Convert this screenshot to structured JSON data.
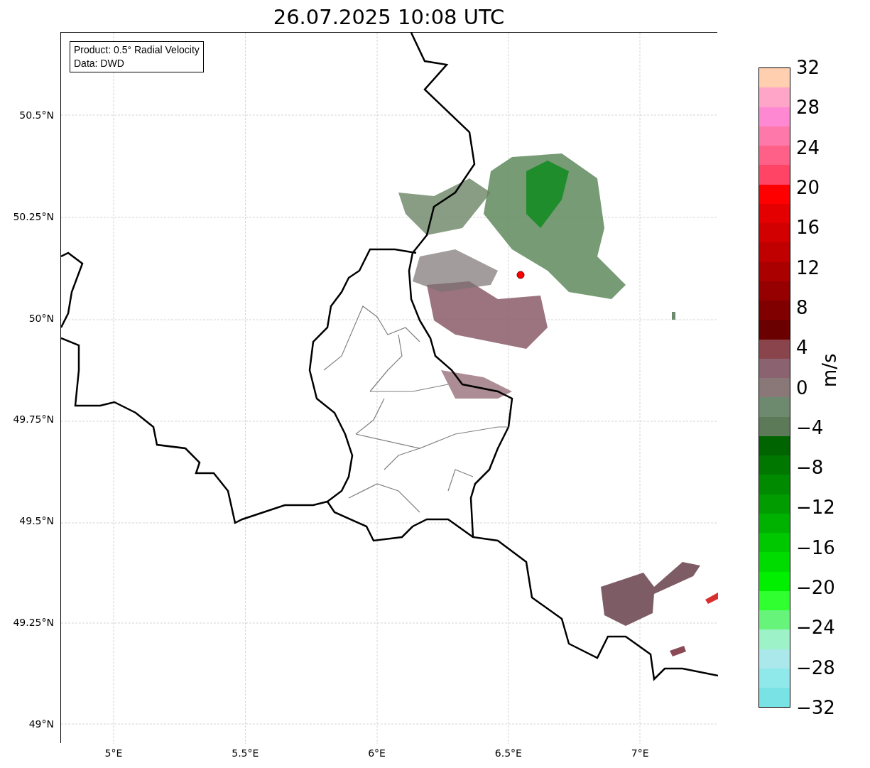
{
  "title": "26.07.2025 10:08 UTC",
  "info_box": [
    "Product: 0.5° Radial Velocity",
    "Data: DWD"
  ],
  "lat_ticks": [
    "50.5°N",
    "50.25°N",
    "50°N",
    "49.75°N",
    "49.5°N",
    "49.25°N",
    "49°N"
  ],
  "lon_ticks": [
    "5°E",
    "5.5°E",
    "6°E",
    "6.5°E",
    "7°E"
  ],
  "colorbar": {
    "label": "m/s",
    "ticks": [
      "32",
      "28",
      "24",
      "20",
      "16",
      "12",
      "8",
      "4",
      "0",
      "−4",
      "−8",
      "−12",
      "−16",
      "−20",
      "−24",
      "−28",
      "−32"
    ],
    "bands": [
      {
        "color": "#ffcfb0"
      },
      {
        "color": "#ffa6c8"
      },
      {
        "color": "#ff88d2"
      },
      {
        "color": "#ff78aa"
      },
      {
        "color": "#ff6088"
      },
      {
        "color": "#ff4466"
      },
      {
        "color": "#ff0000"
      },
      {
        "color": "#e40000"
      },
      {
        "color": "#d20000"
      },
      {
        "color": "#c00000"
      },
      {
        "color": "#aa0000"
      },
      {
        "color": "#960000"
      },
      {
        "color": "#800000"
      },
      {
        "color": "#6b0000"
      },
      {
        "color": "#8a454c"
      },
      {
        "color": "#8a6270"
      },
      {
        "color": "#8a7878"
      },
      {
        "color": "#6e8a6e"
      },
      {
        "color": "#5c7a58"
      },
      {
        "color": "#006400"
      },
      {
        "color": "#007800"
      },
      {
        "color": "#008a00"
      },
      {
        "color": "#009c00"
      },
      {
        "color": "#00b200"
      },
      {
        "color": "#00c800"
      },
      {
        "color": "#00dc00"
      },
      {
        "color": "#00f000"
      },
      {
        "color": "#30ff30"
      },
      {
        "color": "#66f57a"
      },
      {
        "color": "#9df2c8"
      },
      {
        "color": "#aae8ec"
      },
      {
        "color": "#8fe8ea"
      },
      {
        "color": "#78e2e4"
      }
    ]
  }
}
